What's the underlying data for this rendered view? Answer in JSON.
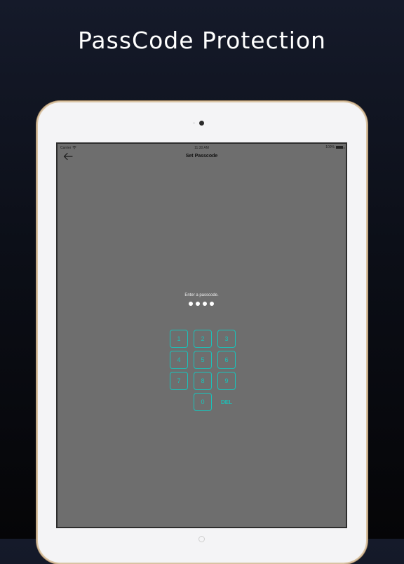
{
  "headline": "PassCode Protection",
  "status_bar": {
    "carrier": "Carrier",
    "wifi_icon": "wifi-icon",
    "time": "11:30 AM",
    "battery_percent": "100%",
    "battery_icon": "battery-icon"
  },
  "nav": {
    "back_icon": "arrow-left-icon",
    "title": "Set Passcode"
  },
  "passcode": {
    "prompt": "Enter a passcode.",
    "entered_digits": 4,
    "length": 4
  },
  "keypad": {
    "keys": [
      "1",
      "2",
      "3",
      "4",
      "5",
      "6",
      "7",
      "8",
      "9",
      "0"
    ],
    "delete_label": "DEL"
  },
  "colors": {
    "screen_background": "#6e6e6e",
    "accent": "#19c3bb",
    "dot": "#ffffff",
    "device_frame": "#f4f4f6",
    "device_border_gold": "#d9c3a3"
  }
}
